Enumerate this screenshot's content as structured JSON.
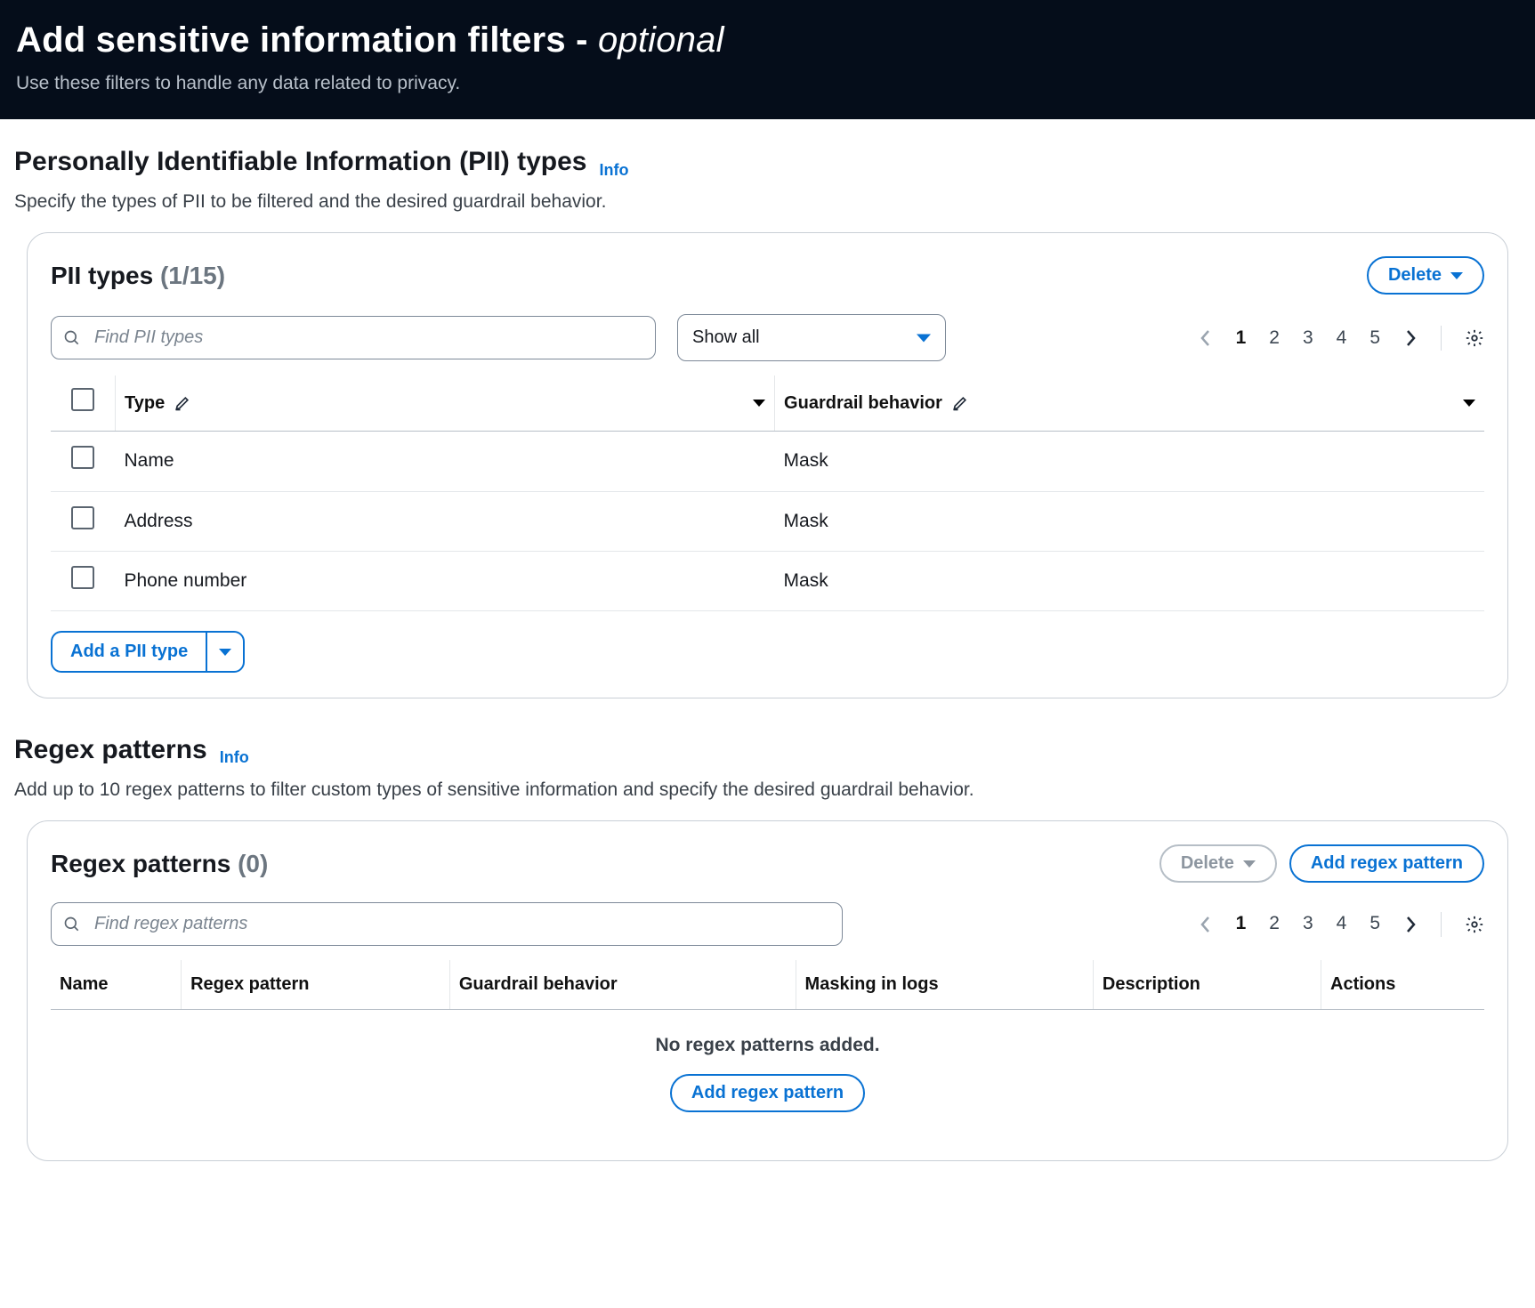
{
  "header": {
    "title_main": "Add sensitive information filters - ",
    "title_suffix": "optional",
    "subtitle": "Use these filters to handle any data related to privacy."
  },
  "pii": {
    "section_title": "Personally Identifiable Information (PII) types",
    "info": "Info",
    "section_desc": "Specify the types of PII to be filtered and the desired guardrail behavior.",
    "panel_title": "PII types ",
    "panel_count": "(1/15)",
    "delete": "Delete",
    "search_placeholder": "Find PII types",
    "filter_value": "Show all",
    "pager": {
      "pages": [
        "1",
        "2",
        "3",
        "4",
        "5"
      ],
      "active": "1"
    },
    "cols": {
      "type": "Type",
      "behavior": "Guardrail behavior"
    },
    "rows": [
      {
        "type": "Name",
        "behavior": "Mask"
      },
      {
        "type": "Address",
        "behavior": "Mask"
      },
      {
        "type": "Phone number",
        "behavior": "Mask"
      }
    ],
    "add_btn": "Add a PII type"
  },
  "regex": {
    "section_title": "Regex patterns",
    "info": "Info",
    "section_desc": "Add up to 10 regex patterns to filter custom types of sensitive information and specify the desired guardrail behavior.",
    "panel_title": "Regex patterns ",
    "panel_count": "(0)",
    "delete": "Delete",
    "add_btn": "Add regex pattern",
    "search_placeholder": "Find regex patterns",
    "pager": {
      "pages": [
        "1",
        "2",
        "3",
        "4",
        "5"
      ],
      "active": "1"
    },
    "cols": {
      "name": "Name",
      "pattern": "Regex pattern",
      "behavior": "Guardrail behavior",
      "masking": "Masking in logs",
      "desc": "Description",
      "actions": "Actions"
    },
    "empty": "No regex patterns added.",
    "empty_cta": "Add regex pattern"
  }
}
